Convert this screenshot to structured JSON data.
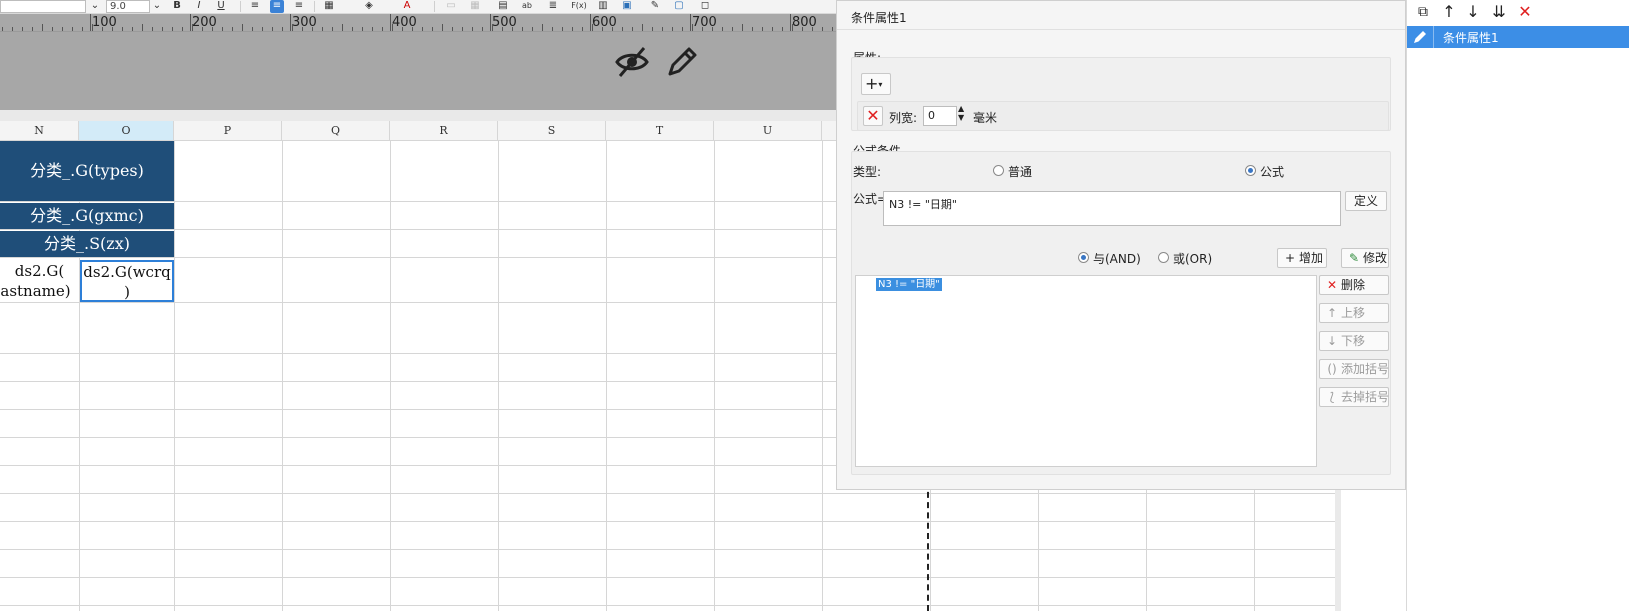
{
  "toolbar": {
    "font_size_value": "9.0",
    "icons": [
      "dropdown-icon",
      "dropdown-icon",
      "bold-icon",
      "italic-icon",
      "underline-icon",
      "align-left-icon",
      "align-center-icon",
      "align-right-icon",
      "border-icon",
      "fill-color-icon",
      "font-color-icon",
      "merge-icon",
      "split-icon",
      "wrap-text-icon",
      "text-format-icon",
      "align-icon",
      "formula-icon",
      "chart-icon",
      "image-icon",
      "brush-icon",
      "sheet-icon",
      "shape-icon"
    ],
    "bold": "B",
    "italic": "I",
    "underline": "U",
    "fx": "F(x)",
    "ab": "ab"
  },
  "ruler": {
    "labels": [
      "100",
      "200",
      "300",
      "400",
      "500",
      "600",
      "700",
      "800"
    ]
  },
  "band": {
    "icons": [
      "hide-eye-icon",
      "edit-pencil-icon"
    ]
  },
  "sheet": {
    "columns": [
      "N",
      "O",
      "P",
      "Q",
      "R",
      "S",
      "T",
      "U"
    ],
    "selected_column": "O",
    "cells": {
      "types": "分类_.G(types)",
      "gxmc": "分类_.G(gxmc)",
      "zx": "分类_.S(zx)",
      "n_line1": "ds2.G(",
      "n_line2": "astname)",
      "o_line1": "ds2.G(wcrq",
      "o_line2": ")"
    }
  },
  "dialog": {
    "title": "条件属性1",
    "attr_group_label": "属性:",
    "add_icon": "plus-icon",
    "column_width_label": "列宽:",
    "column_width_value": "0",
    "unit_label": "毫米",
    "formula_group_label": "公式条件",
    "type_label": "类型:",
    "type_normal": "普通",
    "type_formula": "公式",
    "type_selected": "公式",
    "formula_label": "公式=",
    "formula_value": "N3 != \"日期\"",
    "define_button": "定义",
    "and_label": "与(AND)",
    "or_label": "或(OR)",
    "logic_selected": "AND",
    "add_button": "增加",
    "modify_button": "修改",
    "delete_button": "删除",
    "move_up_button": "上移",
    "move_down_button": "下移",
    "add_bracket_button": "添加括号",
    "remove_bracket_button": "去掉括号",
    "conditions": [
      "N3 != \"日期\""
    ]
  },
  "right_panel": {
    "icons": [
      "copy-icon",
      "arrow-up-icon",
      "arrow-down-icon",
      "sort-icon",
      "delete-x-icon"
    ],
    "items": [
      {
        "label": "条件属性1",
        "icon": "pencil-icon",
        "selected": true
      }
    ]
  },
  "colors": {
    "header_blue": "#1f4e79",
    "selection_blue": "#3b8fe0",
    "delete_red": "#e02020"
  }
}
